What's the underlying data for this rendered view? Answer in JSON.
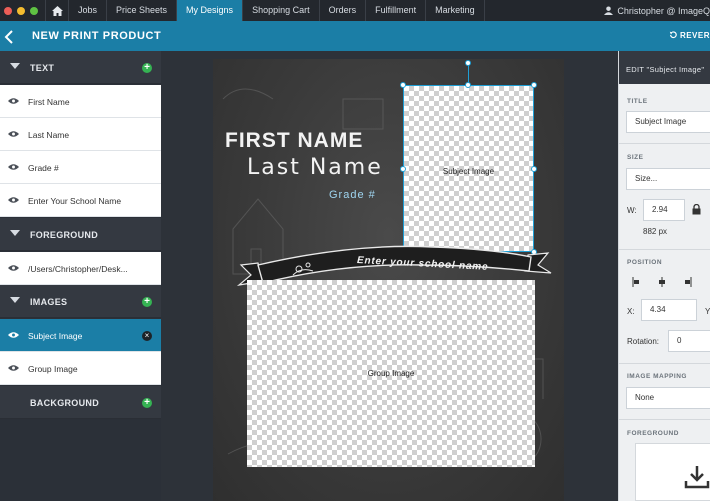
{
  "window": {
    "controls": {
      "close": "#ec5e57",
      "minimize": "#f4bc2f",
      "maximize": "#5fc243"
    }
  },
  "nav": {
    "tabs": [
      {
        "label": "Jobs"
      },
      {
        "label": "Price Sheets"
      },
      {
        "label": "My Designs"
      },
      {
        "label": "Shopping Cart"
      },
      {
        "label": "Orders"
      },
      {
        "label": "Fulfillment"
      },
      {
        "label": "Marketing"
      }
    ],
    "active_tab": "My Designs",
    "user": "Christopher @ ImageQ"
  },
  "header": {
    "title": "NEW PRINT PRODUCT",
    "revert_label": "REVER"
  },
  "layers": {
    "text_section": "TEXT",
    "text_items": [
      "First Name",
      "Last Name",
      "Grade #",
      "Enter Your School Name"
    ],
    "foreground_section": "FOREGROUND",
    "foreground_items": [
      "/Users/Christopher/Desk..."
    ],
    "images_section": "IMAGES",
    "image_items": [
      "Subject Image",
      "Group Image"
    ],
    "selected_item": "Subject Image",
    "background_section": "BACKGROUND"
  },
  "design": {
    "first_name": "FIRST NAME",
    "last_name": "Last Name",
    "grade": "Grade #",
    "school_banner": "Enter your school name",
    "subject_placeholder": "Subject Image",
    "group_placeholder": "Group Image"
  },
  "edit_panel": {
    "header": "EDIT \"Subject Image\"",
    "title_label": "TITLE",
    "title_value": "Subject Image",
    "size_label": "SIZE",
    "size_value": "Size...",
    "width_label": "W:",
    "width_value": "2.94",
    "width_px": "882 px",
    "position_label": "POSITION",
    "x_label": "X:",
    "x_value": "4.34",
    "y_label": "Y",
    "rotation_label": "Rotation:",
    "rotation_value": "0",
    "image_mapping_label": "IMAGE MAPPING",
    "image_mapping_value": "None",
    "foreground_label": "FOREGROUND"
  },
  "colors": {
    "accent": "#1b7ea6",
    "add": "#35b353",
    "dark_nav": "#23272d",
    "panel_dark": "#343941"
  }
}
